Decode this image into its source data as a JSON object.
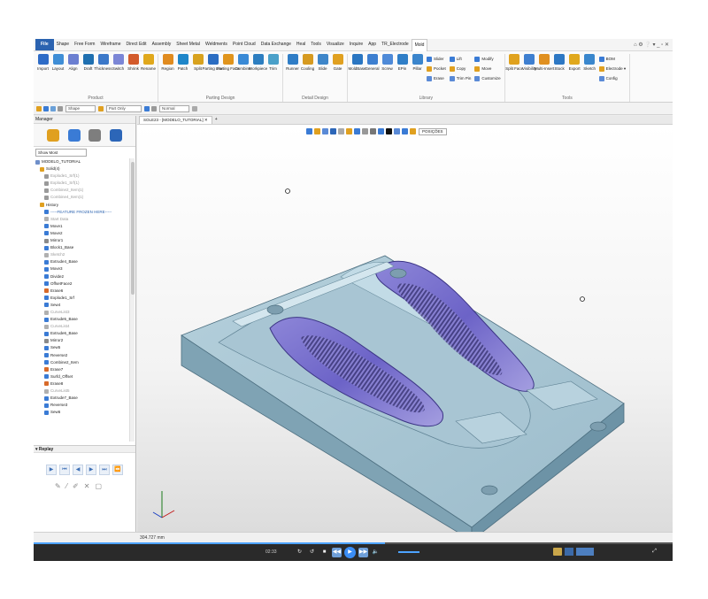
{
  "menubar": {
    "tabs": [
      "File",
      "Shape",
      "Free Form",
      "Wireframe",
      "Direct Edit",
      "Assembly",
      "Sheet Metal",
      "Weldments",
      "Point Cloud",
      "Data Exchange",
      "Heal",
      "Tools",
      "Visualize",
      "Inquire",
      "App",
      "TR_Electrode",
      "Mold"
    ],
    "active_tab": "Mold",
    "window_controls": "⌂ ⚙ ❔ ▾ _ ▫ ✕"
  },
  "ribbon": {
    "groups": [
      {
        "label": "Product",
        "tools": [
          {
            "label": "Import",
            "color": "#2e6cc7"
          },
          {
            "label": "Layout",
            "color": "#3f8ed6"
          },
          {
            "label": "Align",
            "color": "#6b7fd1"
          },
          {
            "label": "Draft",
            "color": "#1f6fb0"
          },
          {
            "label": "Thickness",
            "color": "#3b78c9"
          },
          {
            "label": "Switch",
            "color": "#7b86d6"
          },
          {
            "label": "Shrink",
            "color": "#d35a2b"
          },
          {
            "label": "Rename",
            "color": "#e0a81c"
          }
        ]
      },
      {
        "label": "Parting Design",
        "tools": [
          {
            "label": "Region",
            "color": "#e08b1f"
          },
          {
            "label": "Patch",
            "color": "#1e86c9"
          },
          {
            "label": "Split",
            "color": "#d8a21e"
          },
          {
            "label": "Parting Line",
            "color": "#2b6dc2"
          },
          {
            "label": "Parting Face",
            "color": "#e0941c"
          },
          {
            "label": "Combine",
            "color": "#3a8ad6"
          },
          {
            "label": "Workpiece",
            "color": "#2d7ec0"
          },
          {
            "label": "Trim",
            "color": "#4aa0c9"
          }
        ]
      },
      {
        "label": "Detail Design",
        "tools": [
          {
            "label": "Runner",
            "color": "#2f7dc6"
          },
          {
            "label": "Cooling",
            "color": "#d69a20"
          },
          {
            "label": "Slide",
            "color": "#3e86c9"
          },
          {
            "label": "Gate",
            "color": "#e0a020"
          }
        ]
      },
      {
        "label": "Library",
        "tools": [
          {
            "label": "MoldBase",
            "color": "#2a76c2"
          },
          {
            "label": "General",
            "color": "#3d7fd0"
          },
          {
            "label": "Screw",
            "color": "#4e8ad8"
          },
          {
            "label": "EPin",
            "color": "#2f7ec7"
          },
          {
            "label": "Pillar",
            "color": "#3b85cc"
          }
        ],
        "small": [
          [
            "Slider",
            "Pocket",
            "Erase"
          ],
          [
            "Lift",
            "Copy",
            "Trim Pin"
          ],
          [
            "Modify",
            "Move",
            "Customize"
          ]
        ]
      },
      {
        "label": "Tools",
        "tools": [
          {
            "label": "Split Face",
            "color": "#e0a21e"
          },
          {
            "label": "Visibility",
            "color": "#3e7fd0"
          },
          {
            "label": "Multi-Insert",
            "color": "#e09020"
          },
          {
            "label": "Stock",
            "color": "#2d78c4"
          },
          {
            "label": "Export",
            "color": "#e0a81c"
          },
          {
            "label": "Sketch",
            "color": "#3a87cd"
          }
        ],
        "small": [
          [
            "BOM",
            "Electrode ▾",
            "Config"
          ]
        ]
      }
    ]
  },
  "toolbar2": {
    "combo1": "Shape",
    "combo2": "Part Only",
    "combo3": "Normal"
  },
  "manager": {
    "title": "Manager",
    "filter": "Show Most",
    "tree": [
      {
        "label": "MODELO_TUTORIAL",
        "color": "#6f8fc9",
        "indent": 0,
        "dim": false
      },
      {
        "label": "Solid(4)",
        "color": "#e0a020",
        "indent": 1,
        "dim": false
      },
      {
        "label": "Explode1_Srf(1)",
        "color": "#9a9a9a",
        "indent": 2,
        "dim": true
      },
      {
        "label": "Explode1_Srf(1)",
        "color": "#9a9a9a",
        "indent": 2,
        "dim": true
      },
      {
        "label": "Combine2_Item(1)",
        "color": "#9a9a9a",
        "indent": 2,
        "dim": true
      },
      {
        "label": "Combine4_Item(1)",
        "color": "#9a9a9a",
        "indent": 2,
        "dim": true
      },
      {
        "label": "History",
        "color": "#e0a020",
        "indent": 1,
        "dim": false
      },
      {
        "label": "-----FEATURE FROZEN HERE-----",
        "color": "#3a7bd5",
        "indent": 2,
        "dim": false,
        "accent": true
      },
      {
        "label": "Start Data",
        "color": "#b0b0b0",
        "indent": 2,
        "dim": true
      },
      {
        "label": "Move1",
        "color": "#3a7bd5",
        "indent": 2,
        "dim": false
      },
      {
        "label": "Move2",
        "color": "#3a7bd5",
        "indent": 2,
        "dim": false
      },
      {
        "label": "Mirror1",
        "color": "#8a8a8a",
        "indent": 2,
        "dim": false
      },
      {
        "label": "Block1_Base",
        "color": "#3a7bd5",
        "indent": 2,
        "dim": false
      },
      {
        "label": "Sketch2",
        "color": "#b0b0b0",
        "indent": 2,
        "dim": true
      },
      {
        "label": "Extrude4_Base",
        "color": "#3a7bd5",
        "indent": 2,
        "dim": false
      },
      {
        "label": "Move3",
        "color": "#3a7bd5",
        "indent": 2,
        "dim": false
      },
      {
        "label": "Divide2",
        "color": "#3a7bd5",
        "indent": 2,
        "dim": false
      },
      {
        "label": "OffsetFace2",
        "color": "#3a7bd5",
        "indent": 2,
        "dim": false
      },
      {
        "label": "Erase6",
        "color": "#d86a2a",
        "indent": 2,
        "dim": false
      },
      {
        "label": "Explode1_Srf",
        "color": "#3a7bd5",
        "indent": 2,
        "dim": false
      },
      {
        "label": "Sew4",
        "color": "#3a7bd5",
        "indent": 2,
        "dim": false
      },
      {
        "label": "CurveList3",
        "color": "#b0b0b0",
        "indent": 2,
        "dim": true
      },
      {
        "label": "Extrude5_Base",
        "color": "#3a7bd5",
        "indent": 2,
        "dim": false
      },
      {
        "label": "CurveList4",
        "color": "#b0b0b0",
        "indent": 2,
        "dim": true
      },
      {
        "label": "Extrude6_Base",
        "color": "#3a7bd5",
        "indent": 2,
        "dim": false
      },
      {
        "label": "Mirror2",
        "color": "#8a8a8a",
        "indent": 2,
        "dim": false
      },
      {
        "label": "Sew5",
        "color": "#3a7bd5",
        "indent": 2,
        "dim": false
      },
      {
        "label": "Reverse2",
        "color": "#3a7bd5",
        "indent": 2,
        "dim": false
      },
      {
        "label": "Combine2_Item",
        "color": "#3a7bd5",
        "indent": 2,
        "dim": false
      },
      {
        "label": "Erase7",
        "color": "#d86a2a",
        "indent": 2,
        "dim": false
      },
      {
        "label": "Surfd_Offset",
        "color": "#3a7bd5",
        "indent": 2,
        "dim": false
      },
      {
        "label": "Erase8",
        "color": "#d86a2a",
        "indent": 2,
        "dim": false
      },
      {
        "label": "CurveList5",
        "color": "#b0b0b0",
        "indent": 2,
        "dim": true
      },
      {
        "label": "Extrude7_Base",
        "color": "#3a7bd5",
        "indent": 2,
        "dim": false
      },
      {
        "label": "Reverse3",
        "color": "#3a7bd5",
        "indent": 2,
        "dim": false
      },
      {
        "label": "Sew6",
        "color": "#3a7bd5",
        "indent": 2,
        "dim": false
      }
    ],
    "replay_title": "▾ Replay"
  },
  "doc_tab": "SOLE23 - [MODELO_TUTORIAL] ✕",
  "viewport_toolbar": {
    "combo": "POSIÇÕES"
  },
  "status": {
    "text": "304.727 mm"
  },
  "player": {
    "time": "02:33",
    "progress": 0.55,
    "volume": 0.6
  }
}
